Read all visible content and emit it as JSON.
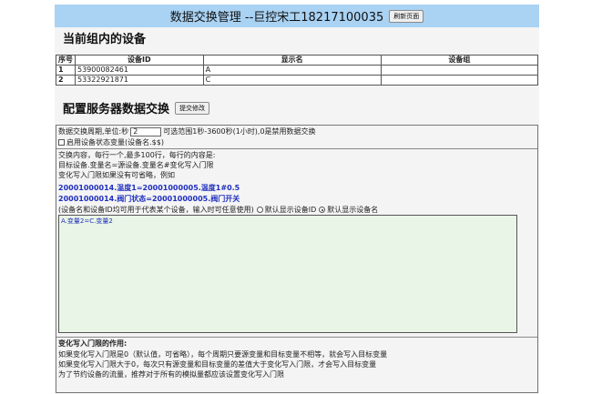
{
  "header": {
    "title": "数据交换管理 --巨控宋工18217100035",
    "refresh_button": "刷新页面"
  },
  "devices_section": {
    "heading": "当前组内的设备",
    "columns": [
      "序号",
      "设备ID",
      "显示名",
      "设备组"
    ],
    "rows": [
      [
        "1",
        "53900082461",
        "A",
        ""
      ],
      [
        "2",
        "53322921871",
        "C",
        ""
      ]
    ]
  },
  "config_section": {
    "heading": "配置服务器数据交换",
    "submit_button": "提交修改",
    "period_label": "数据交换周期,单位:秒",
    "period_value": "2",
    "period_hint": "可选范围1秒-3600秒(1小时),0是禁用数据交换",
    "status_checkbox_label": "启用设备状态变量(设备名.$$)",
    "content_line1": "交换内容，每行一个,最多100行，每行的内容是:",
    "content_line2": "目标设备.变量名=源设备.变量名#变化写入门限",
    "content_line3": "变化写入门限如果没有可省略，例如",
    "example1": "20001000014.温度1=20001000005.温度1#0.5",
    "example2": "20001000014.阀门状态=20001000005.阀门开关",
    "note_line": "(设备名和设备ID均可用于代表某个设备，输入时可任意使用)",
    "radio_id_label": "默认显示设备ID",
    "radio_name_label": "默认显示设备名",
    "textarea_value": "A.变量2=C.变量2",
    "threshold_title": "变化写入门限的作用:",
    "threshold_line1": "如果变化写入门限是0（默认值，可省略），每个周期只要源变量和目标变量不相等，就会写入目标变量",
    "threshold_line2": "如果变化写入门限大于0，每次只有源变量和目标变量的差值大于变化写入门限，才会写入目标变量",
    "threshold_line3": "为了节约设备的流量，推荐对于所有的模拟量都应该设置变化写入门限"
  },
  "colors": {
    "header_bg": "#a9d2f3",
    "textarea_bg": "#e9f5e6",
    "example_text": "#1f2fbf"
  }
}
